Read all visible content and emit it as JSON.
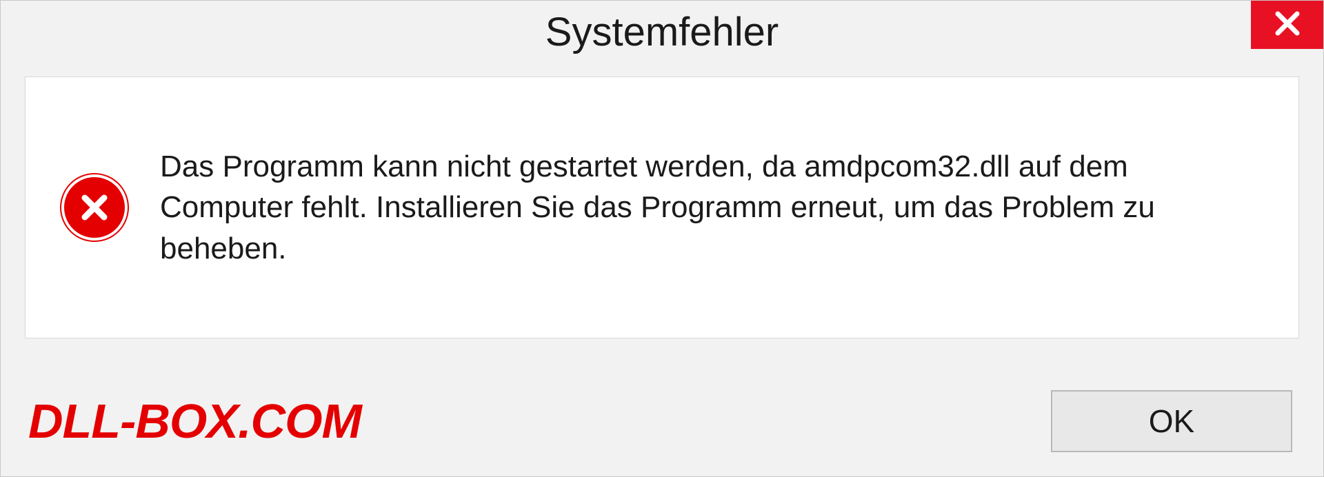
{
  "dialog": {
    "title": "Systemfehler",
    "message": "Das Programm kann nicht gestartet werden, da amdpcom32.dll auf dem Computer fehlt. Installieren Sie das Programm erneut, um das Problem zu beheben.",
    "ok_label": "OK"
  },
  "watermark": "DLL-BOX.COM"
}
